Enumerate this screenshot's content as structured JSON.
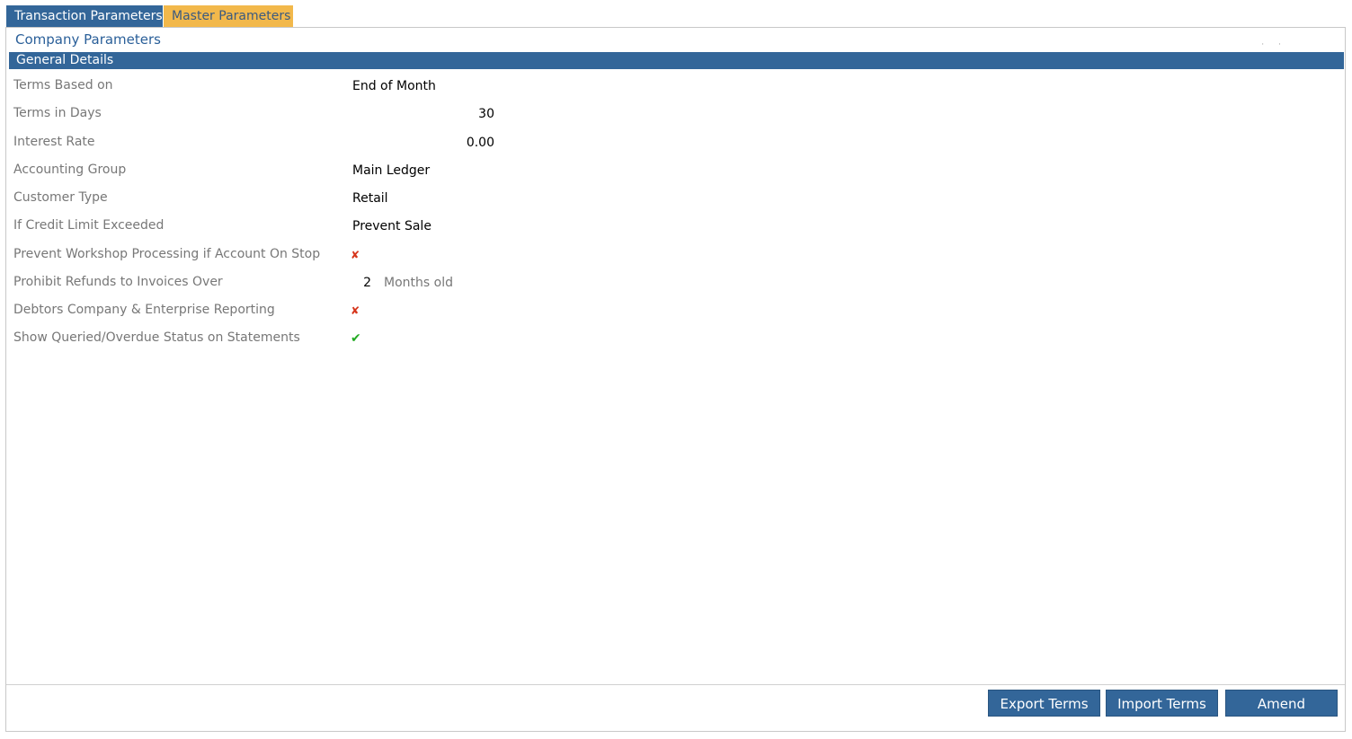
{
  "tabs": [
    {
      "label": "Transaction Parameters",
      "active": true
    },
    {
      "label": "Master Parameters",
      "active": false
    }
  ],
  "panel": {
    "title": "Company Parameters",
    "section": "General Details"
  },
  "fields": {
    "terms_based_on": {
      "label": "Terms Based on",
      "value": "End of Month"
    },
    "terms_in_days": {
      "label": "Terms in Days",
      "value": "30"
    },
    "interest_rate": {
      "label": "Interest Rate",
      "value": "0.00"
    },
    "accounting_group": {
      "label": "Accounting Group",
      "value": "Main Ledger"
    },
    "customer_type": {
      "label": "Customer Type",
      "value": "Retail"
    },
    "credit_limit": {
      "label": "If Credit Limit Exceeded",
      "value": "Prevent Sale"
    },
    "prevent_workshop": {
      "label": "Prevent Workshop Processing if Account On Stop",
      "icon": "cross-icon",
      "value": false
    },
    "prohibit_refunds": {
      "label": "Prohibit Refunds to Invoices Over",
      "value": "2",
      "suffix": "Months old"
    },
    "debtors_reporting": {
      "label": "Debtors Company & Enterprise Reporting",
      "icon": "cross-icon",
      "value": false
    },
    "show_queried": {
      "label": "Show Queried/Overdue Status on Statements",
      "icon": "check-icon",
      "value": true
    }
  },
  "buttons": {
    "export": "Export Terms",
    "import": "Import Terms",
    "amend": "Amend"
  },
  "colors": {
    "primary": "#336699",
    "tab_inactive": "#f2b84b",
    "cross": "#d6341a",
    "check": "#22aa22"
  }
}
